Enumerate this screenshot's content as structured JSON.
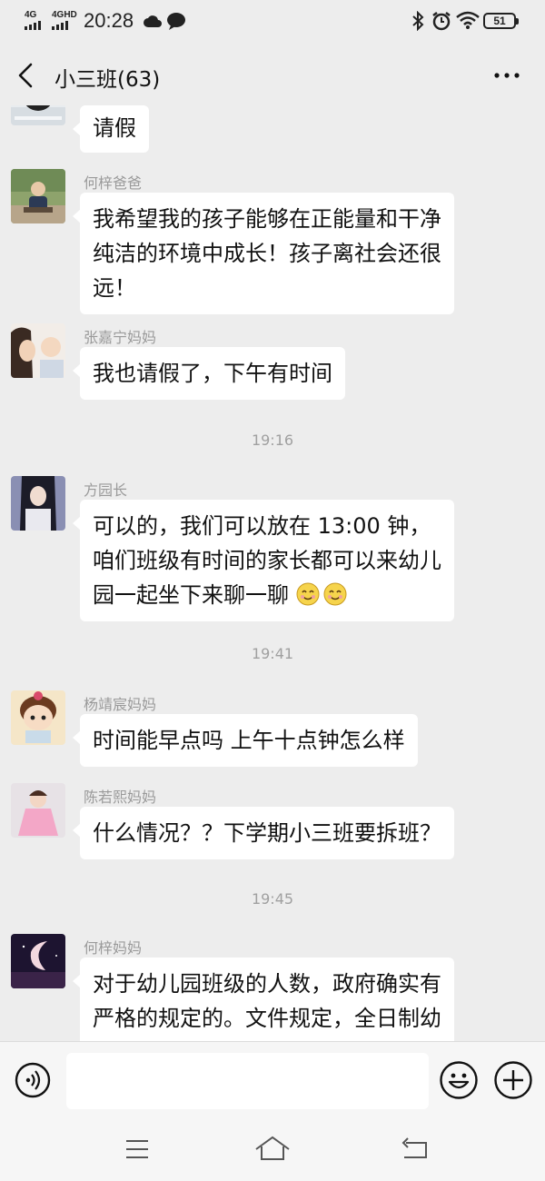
{
  "status_bar": {
    "sig1": "4G",
    "sig2": "4GHD",
    "time": "20:28",
    "battery": "51"
  },
  "header": {
    "title": "小三班(63)"
  },
  "messages": [
    {
      "sender": "",
      "text": "请假"
    },
    {
      "sender": "何梓爸爸",
      "text": "我希望我的孩子能够在正能量和干净纯洁的环境中成长！孩子离社会还很远！"
    },
    {
      "sender": "张嘉宁妈妈",
      "text": "我也请假了，下午有时间"
    },
    {
      "sender": "方园长",
      "text": "可以的，我们可以放在 13:00 钟，咱们班级有时间的家长都可以来幼儿园一起坐下来聊一聊"
    },
    {
      "sender": "杨靖宸妈妈",
      "text": "时间能早点吗  上午十点钟怎么样"
    },
    {
      "sender": "陈若熙妈妈",
      "text": "什么情况？？下学期小三班要拆班？"
    },
    {
      "sender": "何梓妈妈",
      "text": "对于幼儿园班级的人数，政府确实有严格的规定的。文件规定，全日制幼儿园的小班、中班、大班幼儿"
    }
  ],
  "timestamps": [
    "19:16",
    "19:41",
    "19:45"
  ],
  "input": {
    "placeholder": ""
  },
  "icons": {
    "back": "back-arrow-icon",
    "more": "more-dots-icon",
    "voice": "voice-icon",
    "emoji": "emoji-icon",
    "plus": "plus-icon"
  }
}
